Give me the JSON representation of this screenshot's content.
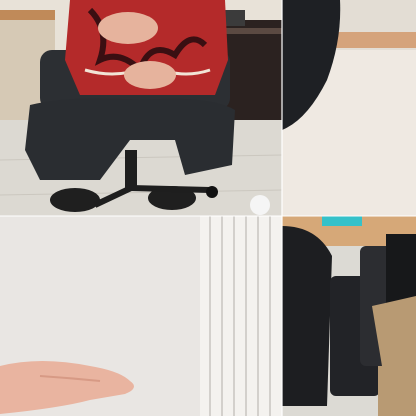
{
  "collage": {
    "layout": "2x2",
    "panels": [
      {
        "id": "top-left",
        "subject": "person-seated-on-office-chair"
      },
      {
        "id": "top-right",
        "subject": "dark-hair-near-wall"
      },
      {
        "id": "bottom-left",
        "subject": "hand-near-vertical-blinds"
      },
      {
        "id": "bottom-right",
        "subject": "person-on-dark-sofa"
      }
    ]
  },
  "colors": {
    "shirt_red": "#b42a2a",
    "shirt_dark": "#3a0f12",
    "pants": "#2a2d31",
    "floor": "#dcd9d2",
    "wall": "#efe9e2",
    "skin": "#e9b4a0",
    "sofa": "#1d1e21",
    "khaki": "#b89a73",
    "wood": "#b07a4b"
  }
}
